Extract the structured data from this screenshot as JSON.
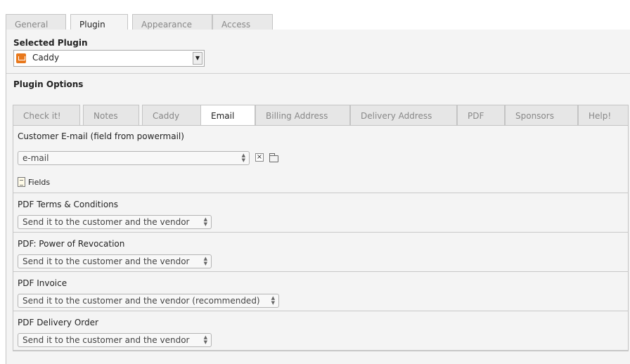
{
  "top_tabs": [
    {
      "label": "General",
      "active": false
    },
    {
      "label": "Plugin",
      "active": true
    },
    {
      "label": "Appearance",
      "active": false
    },
    {
      "label": "Access",
      "active": false
    }
  ],
  "selected_plugin": {
    "heading": "Selected Plugin",
    "value": "Caddy",
    "icon": "cart-icon"
  },
  "plugin_options": {
    "heading": "Plugin Options",
    "tabs": [
      {
        "label": "Check it!",
        "active": false
      },
      {
        "label": "Notes",
        "active": false
      },
      {
        "label": "Caddy",
        "active": false
      },
      {
        "label": "Email",
        "active": true
      },
      {
        "label": "Billing Address",
        "active": false
      },
      {
        "label": "Delivery Address",
        "active": false
      },
      {
        "label": "PDF",
        "active": false
      },
      {
        "label": "Sponsors",
        "active": false
      },
      {
        "label": "Help!",
        "active": false
      }
    ]
  },
  "email": {
    "customer_email": {
      "label": "Customer E-mail (field from powermail)",
      "value": "e-mail",
      "clear_symbol": "×",
      "fields_label": "Fields"
    },
    "pdf_terms": {
      "label": "PDF Terms & Conditions",
      "value": "Send it to the customer and the vendor"
    },
    "pdf_revocation": {
      "label": "PDF: Power of Revocation",
      "value": "Send it to the customer and the vendor"
    },
    "pdf_invoice": {
      "label": "PDF Invoice",
      "value": "Send it to the customer and the vendor (recommended)"
    },
    "pdf_delivery": {
      "label": "PDF Delivery Order",
      "value": "Send it to the customer and the vendor"
    }
  },
  "spinner_symbols": {
    "up": "▲",
    "down": "▼"
  }
}
